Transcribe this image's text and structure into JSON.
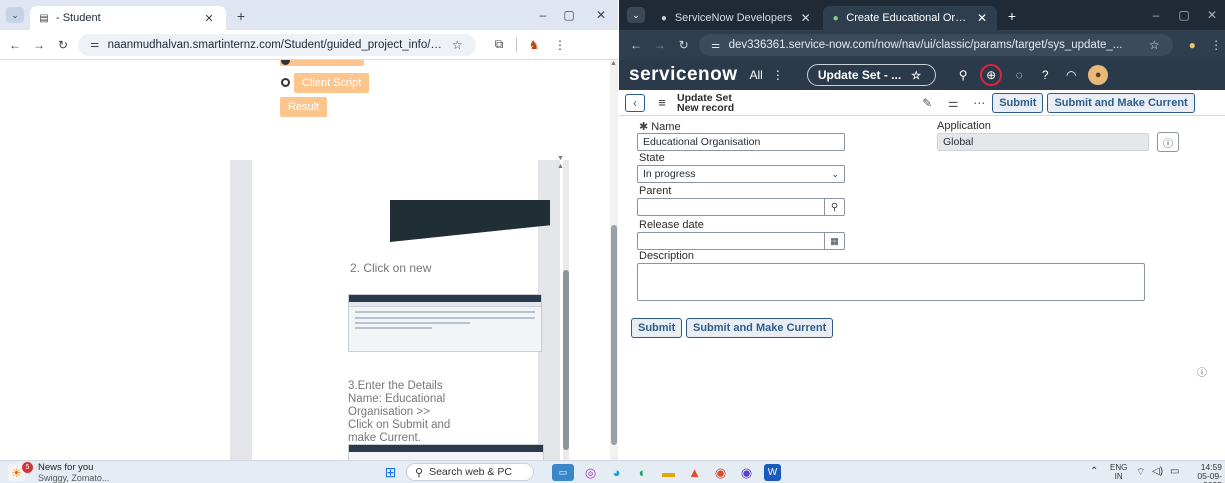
{
  "left_browser": {
    "tab_title": "- Student",
    "url": "naanmudhalvan.smartinternz.com/Student/guided_project_info/14...",
    "buttons": {
      "client_script": "Client Script",
      "result": "Result"
    },
    "steps": {
      "click_new": "2. Click on new",
      "enter_details_lines": [
        "3.Enter the Details",
        "Name: Educational",
        "Organisation >>",
        "Click on Submit and",
        "make Current."
      ]
    }
  },
  "right_browser": {
    "tabs": [
      {
        "title": "ServiceNow Developers"
      },
      {
        "title": "Create Educational Organisation"
      }
    ],
    "url": "dev336361.service-now.com/now/nav/ui/classic/params/target/sys_update_...",
    "sn": {
      "logo": "servicenow",
      "all_label": "All",
      "context_pill": "Update Set - ..."
    },
    "form_header": {
      "title": "Update Set",
      "subtitle": "New record",
      "submit_label": "Submit",
      "submit_make_current_label": "Submit and Make Current"
    },
    "form": {
      "name_label": "Name",
      "name_value": "Educational Organisation",
      "application_label": "Application",
      "application_value": "Global",
      "state_label": "State",
      "state_value": "In progress",
      "parent_label": "Parent",
      "release_date_label": "Release date",
      "description_label": "Description"
    },
    "bottom_buttons": {
      "submit": "Submit",
      "submit_make_current": "Submit and Make Current"
    }
  },
  "taskbar": {
    "news_title": "News for you",
    "news_sub": "Swiggy, Zomato...",
    "search_placeholder": "Search web & PC",
    "lang_top": "ENG",
    "lang_bottom": "IN",
    "time": "14:59",
    "date": "05-09-2025",
    "badge": "5"
  },
  "colors": {
    "accent": "#fbc58d",
    "sn_nav": "#2b3a4a",
    "sn_button": "#2e5c8a"
  }
}
